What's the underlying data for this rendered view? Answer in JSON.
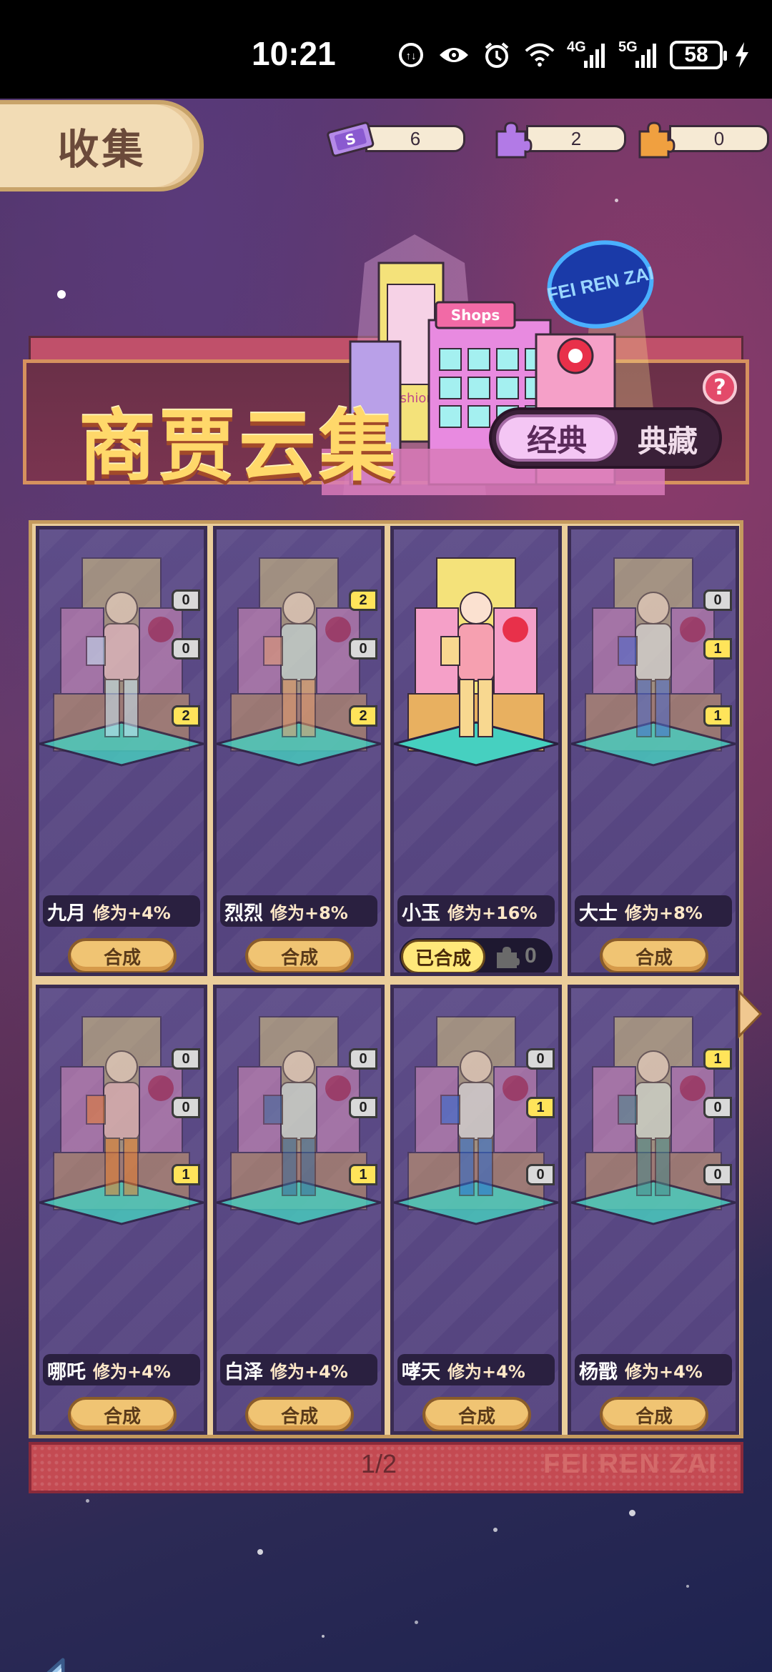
{
  "status_bar": {
    "time": "10:21",
    "network_4g": "4G",
    "network_5g": "5G",
    "battery": "58"
  },
  "header": {
    "title": "收集",
    "currencies": [
      {
        "icon": "ticket-icon",
        "value": "6"
      },
      {
        "icon": "purple-puzzle-icon",
        "value": "2"
      },
      {
        "icon": "orange-puzzle-icon",
        "value": "0"
      }
    ]
  },
  "banner": {
    "title": "商贾云集",
    "tab_active": "经典",
    "tab_inactive": "典藏",
    "help": "?",
    "neon_sign": "FEI REN ZAI",
    "sign_shops": "Shops",
    "sign_fashion": "fashion"
  },
  "cards": [
    {
      "name": "九月",
      "cultivation": "修为+4%",
      "badges": [
        "0",
        "0",
        "2"
      ],
      "action": "合成",
      "completed": false
    },
    {
      "name": "烈烈",
      "cultivation": "修为+8%",
      "badges": [
        "2",
        "0",
        "2"
      ],
      "action": "合成",
      "completed": false
    },
    {
      "name": "小玉",
      "cultivation": "修为+16%",
      "badges": [],
      "action": "已合成",
      "completed": true,
      "count": "0"
    },
    {
      "name": "大士",
      "cultivation": "修为+8%",
      "badges": [
        "0",
        "1",
        "1"
      ],
      "action": "合成",
      "completed": false
    },
    {
      "name": "哪吒",
      "cultivation": "修为+4%",
      "badges": [
        "0",
        "0",
        "1"
      ],
      "action": "合成",
      "completed": false
    },
    {
      "name": "白泽",
      "cultivation": "修为+4%",
      "badges": [
        "0",
        "0",
        "1"
      ],
      "action": "合成",
      "completed": false
    },
    {
      "name": "哮天",
      "cultivation": "修为+4%",
      "badges": [
        "0",
        "1",
        "0"
      ],
      "action": "合成",
      "completed": false
    },
    {
      "name": "杨戬",
      "cultivation": "修为+4%",
      "badges": [
        "1",
        "0",
        "0"
      ],
      "action": "合成",
      "completed": false
    }
  ],
  "pagination": {
    "label": "1/2",
    "brand": "FEI REN ZAI"
  },
  "colors": {
    "accent_gold": "#ffd86a",
    "card_bg": "#5d4c88",
    "button": "#f0c473",
    "badge_gold": "#ffe45a"
  }
}
